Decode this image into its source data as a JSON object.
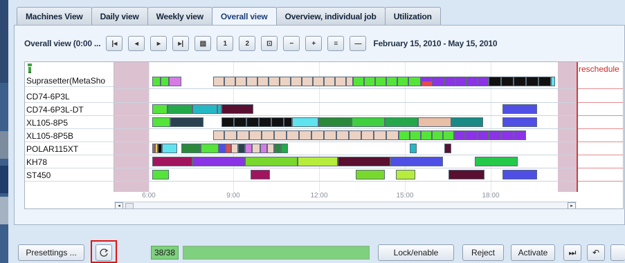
{
  "tabs": [
    {
      "label": "Machines View",
      "active": false
    },
    {
      "label": "Daily view",
      "active": false
    },
    {
      "label": "Weekly view",
      "active": false
    },
    {
      "label": "Overall view",
      "active": true
    },
    {
      "label": "Overview, individual job",
      "active": false
    },
    {
      "label": "Utilization",
      "active": false
    }
  ],
  "toolbar": {
    "label": "Overall view  (0:00 ...",
    "btn_first": "|◂",
    "btn_prev": "◂",
    "btn_next": "▸",
    "btn_last": "▸|",
    "btn_calendar": "▤",
    "btn_one": "1",
    "btn_two": "2",
    "btn_zoom_fit": "⊡",
    "btn_zoom_out": "−",
    "btn_zoom_in": "+",
    "btn_list": "≡",
    "btn_minus": "—",
    "date_range": "February 15, 2010  -  May 15, 2010"
  },
  "grid": {
    "reschedule_label": "reschedule",
    "resources": [
      "Suprasetter(MetaSho",
      "CD74-6P3L",
      "CD74-6P3L-DT",
      "XL105-8P5",
      "XL105-8P5B",
      "POLAR115XT",
      "KH78",
      "ST450"
    ],
    "ticks": [
      "6:00",
      "9:00",
      "12:00",
      "15:00",
      "18:00"
    ],
    "scroll_prev": "◂",
    "scroll_next": "▸"
  },
  "bottom": {
    "presettings": "Presettings ...",
    "refresh_icon": "refresh-icon",
    "progress_text": "38/38",
    "progress_fraction": 1.0,
    "lock_enable": "Lock/enable",
    "reject": "Reject",
    "activate": "Activate",
    "skip_icon": "⏭",
    "undo_icon": "↶"
  }
}
